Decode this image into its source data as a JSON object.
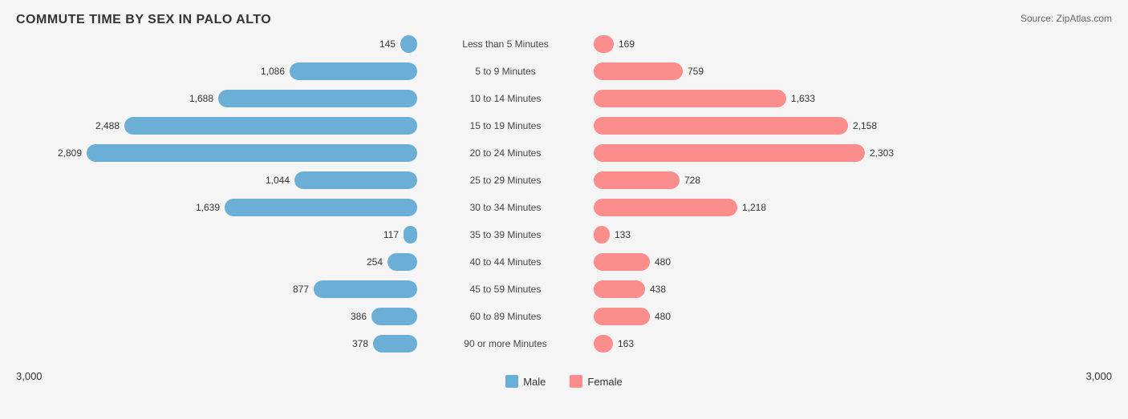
{
  "title": "COMMUTE TIME BY SEX IN PALO ALTO",
  "source": "Source: ZipAtlas.com",
  "maxValue": 3000,
  "rows": [
    {
      "label": "Less than 5 Minutes",
      "male": 145,
      "female": 169
    },
    {
      "label": "5 to 9 Minutes",
      "male": 1086,
      "female": 759
    },
    {
      "label": "10 to 14 Minutes",
      "male": 1688,
      "female": 1633
    },
    {
      "label": "15 to 19 Minutes",
      "male": 2488,
      "female": 2158
    },
    {
      "label": "20 to 24 Minutes",
      "male": 2809,
      "female": 2303
    },
    {
      "label": "25 to 29 Minutes",
      "male": 1044,
      "female": 728
    },
    {
      "label": "30 to 34 Minutes",
      "male": 1639,
      "female": 1218
    },
    {
      "label": "35 to 39 Minutes",
      "male": 117,
      "female": 133
    },
    {
      "label": "40 to 44 Minutes",
      "male": 254,
      "female": 480
    },
    {
      "label": "45 to 59 Minutes",
      "male": 877,
      "female": 438
    },
    {
      "label": "60 to 89 Minutes",
      "male": 386,
      "female": 480
    },
    {
      "label": "90 or more Minutes",
      "male": 378,
      "female": 163
    }
  ],
  "legend": {
    "male": "Male",
    "female": "Female"
  },
  "axis": {
    "left": "3,000",
    "right": "3,000"
  }
}
